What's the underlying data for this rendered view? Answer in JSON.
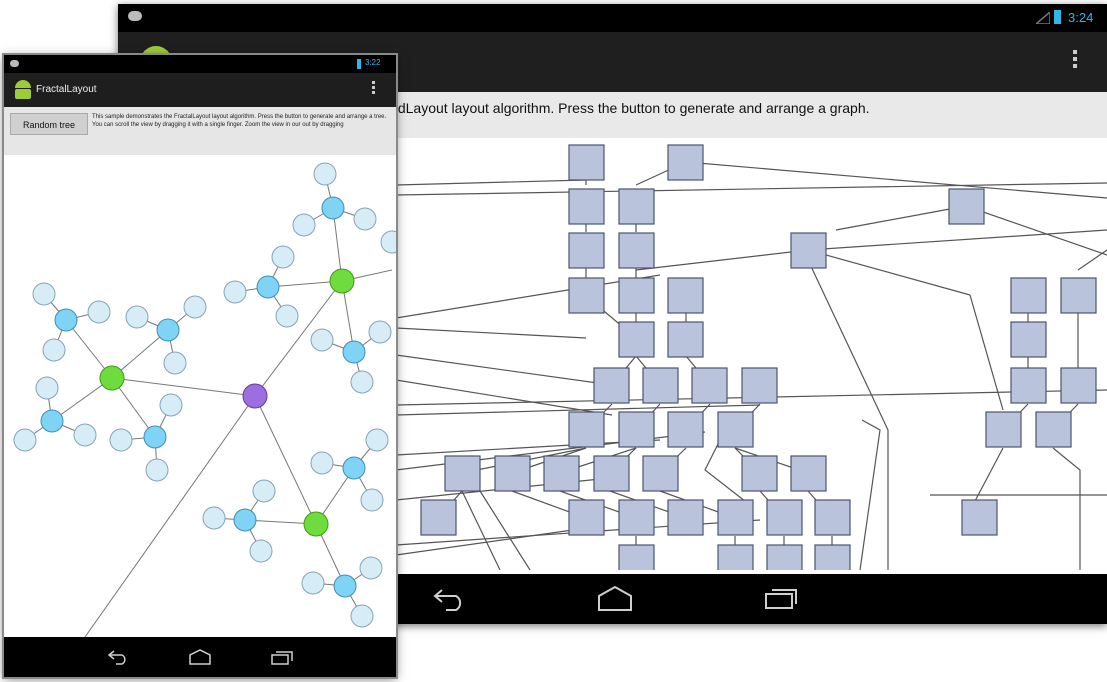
{
  "tablet": {
    "clock": "3:24",
    "description": "nstrates the LayeredLayout layout algorithm. Press the button to generate and arrange a graph."
  },
  "phone": {
    "clock": "3:22",
    "title": "FractalLayout",
    "button_label": "Random tree",
    "description": "This sample demonstrates the FractalLayout layout algorithm. Press the button to generate and arrange a tree. You can scroll the view by dragging it with a single finger. Zoom the view in our out by dragging"
  },
  "icons": {
    "app": "android-robot-icon",
    "back": "back-icon",
    "home": "home-icon",
    "recents": "recent-apps-icon",
    "overflow": "overflow-menu-icon",
    "battery": "battery-icon",
    "signal": "signal-icon",
    "notification": "notification-icon"
  },
  "colors": {
    "layered_node_fill": "#b9c4dc",
    "fractal_leaf": "#d6ecf6",
    "fractal_inner": "#7fd3f4",
    "fractal_hub": "#6edc3c",
    "fractal_root": "#9b6fe0",
    "status_accent": "#33b5e5"
  }
}
